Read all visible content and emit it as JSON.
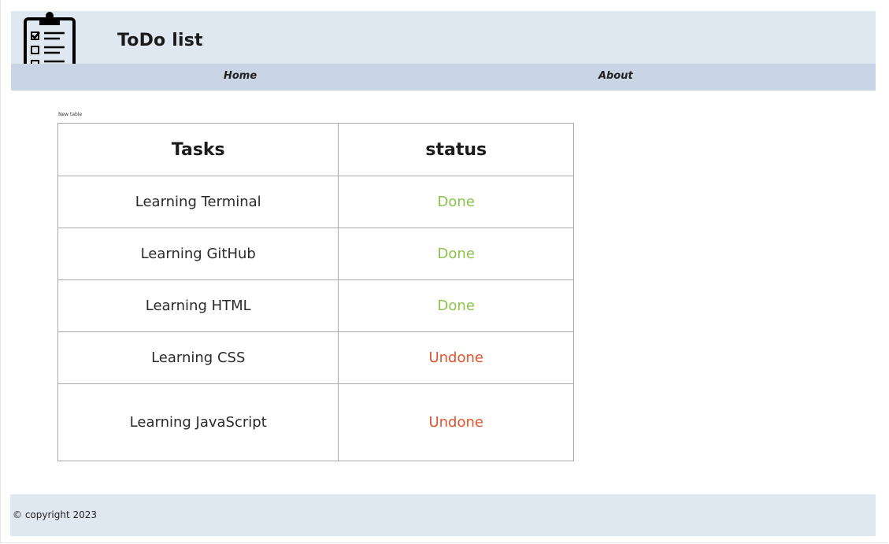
{
  "header": {
    "title": "ToDo list",
    "logo_icon": "clipboard-checklist-icon"
  },
  "nav": {
    "items": [
      {
        "label": "Home"
      },
      {
        "label": "About"
      }
    ]
  },
  "main": {
    "table_caption": "New table",
    "columns": [
      "Tasks",
      "status"
    ],
    "rows": [
      {
        "task": "Learning Terminal",
        "status": "Done"
      },
      {
        "task": "Learning GitHub",
        "status": "Done"
      },
      {
        "task": "Learning HTML",
        "status": "Done"
      },
      {
        "task": "Learning CSS",
        "status": "Undone"
      },
      {
        "task": "Learning JavaScript",
        "status": "Undone"
      }
    ]
  },
  "footer": {
    "copyright": "© copyright 2023"
  },
  "colors": {
    "header_bg": "#dfe7f1",
    "nav_bg": "#c9d5e5",
    "done": "#8bc34a",
    "undone": "#e0532e"
  }
}
